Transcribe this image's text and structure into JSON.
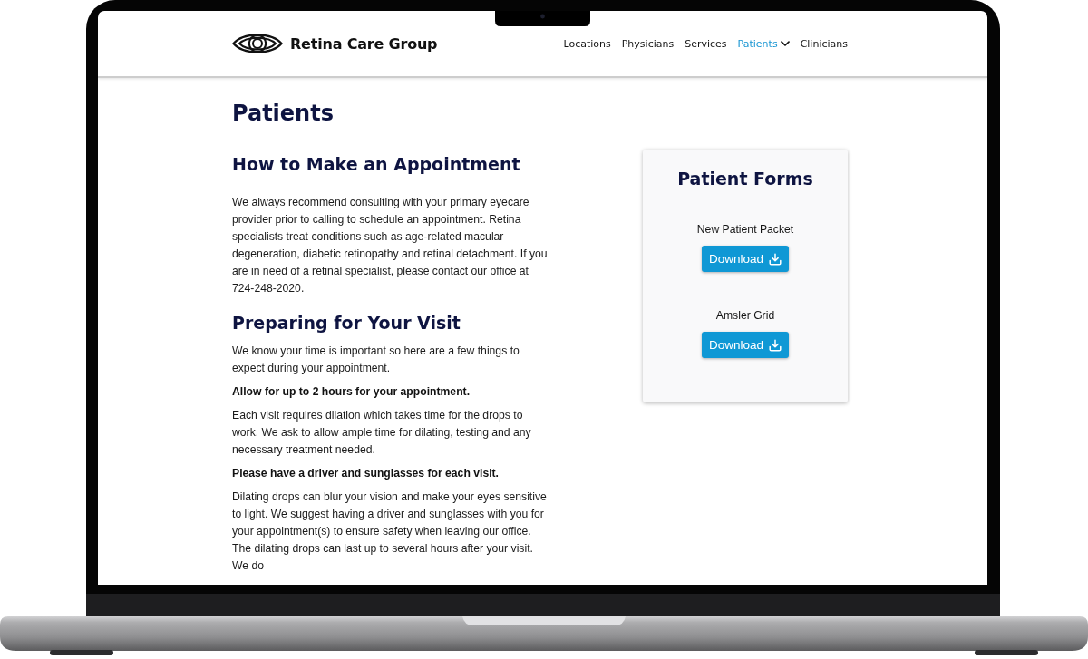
{
  "site": {
    "logo_text": "Retina Care Group"
  },
  "nav": [
    {
      "label": "Locations",
      "selected": false,
      "has_dropdown": false
    },
    {
      "label": "Physicians",
      "selected": false,
      "has_dropdown": false
    },
    {
      "label": "Services",
      "selected": false,
      "has_dropdown": false
    },
    {
      "label": "Patients",
      "selected": true,
      "has_dropdown": true
    },
    {
      "label": "Clinicians",
      "selected": false,
      "has_dropdown": false
    }
  ],
  "page_title": "Patients",
  "sections": [
    {
      "heading": "How to Make an Appointment",
      "blocks": [
        {
          "kind": "text",
          "text": "We always recommend consulting with your primary eyecare provider prior to calling to schedule an appointment. Retina specialists treat conditions such as age-related macular degeneration, diabetic retinopathy and retinal detachment. If you are in need of a retinal specialist, please contact our office at 724-248-2020."
        }
      ]
    },
    {
      "heading": "Preparing for Your Visit",
      "blocks": [
        {
          "kind": "text",
          "text": "We know your time is important so here are a few things to expect during your appointment."
        },
        {
          "kind": "note",
          "text": "Allow for up to 2 hours for your appointment."
        },
        {
          "kind": "text",
          "text": "Each visit requires dilation which takes time for the drops to work. We ask to allow ample time for dilating, testing and any necessary treatment needed."
        },
        {
          "kind": "note",
          "text": "Please have a driver and sunglasses for each visit."
        },
        {
          "kind": "text",
          "text": "Dilating drops can blur your vision and make your eyes sensitive to light. We suggest having a driver and sunglasses with you for your appointment(s) to ensure safety when leaving our office. The dilating drops can last up to several hours after your visit. We do"
        }
      ]
    }
  ],
  "forms_card": {
    "title": "Patient Forms",
    "forms": [
      {
        "name": "New Patient Packet",
        "button": "Download"
      },
      {
        "name": "Amsler Grid",
        "button": "Download"
      }
    ]
  }
}
